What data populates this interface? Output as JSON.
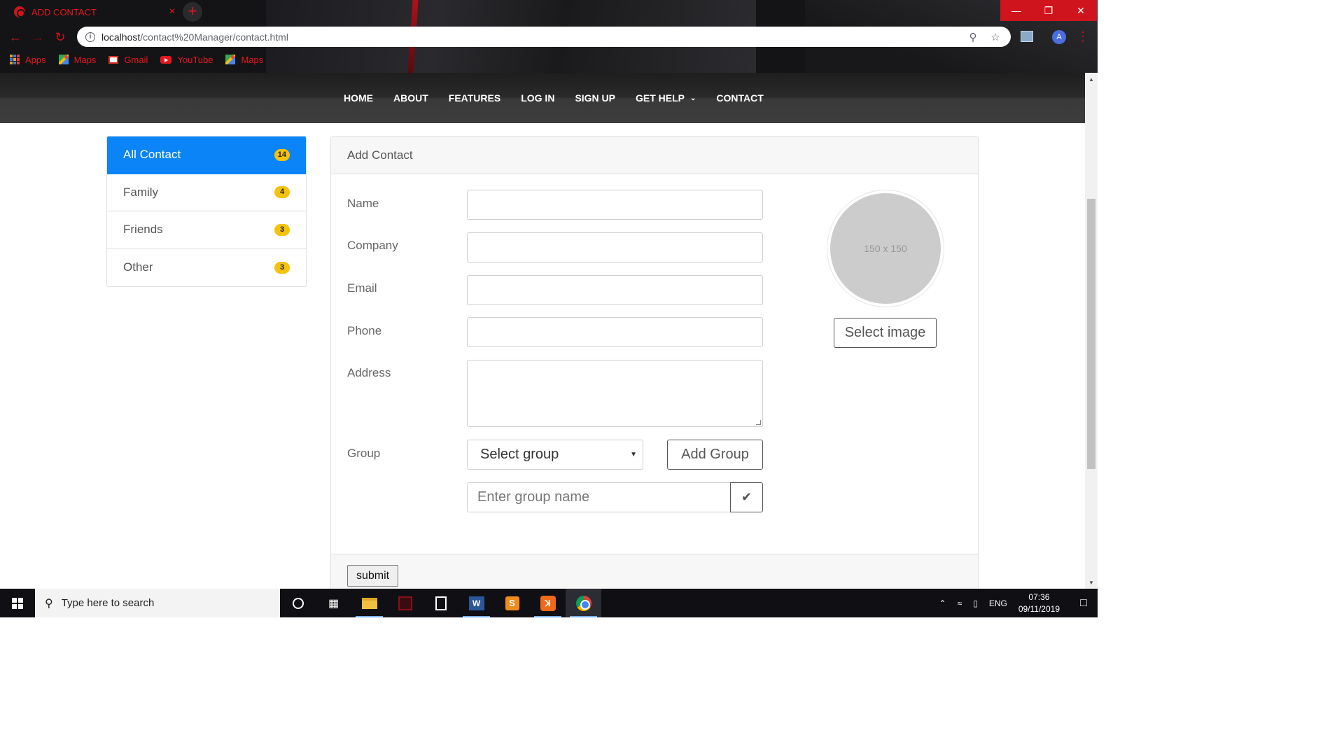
{
  "browser": {
    "tab_title": "ADD CONTACT",
    "tab_close": "×",
    "new_tab": "+",
    "url_host": "localhost",
    "url_path": "/contact%20Manager/contact.html",
    "info_icon": "i",
    "profile_initial": "A",
    "window_controls": {
      "minimize": "—",
      "restore": "❐",
      "close": "✕"
    },
    "bookmarks": [
      {
        "label": "Apps",
        "icon": "apps-icon"
      },
      {
        "label": "Maps",
        "icon": "maps-icon"
      },
      {
        "label": "Gmail",
        "icon": "gmail-icon"
      },
      {
        "label": "YouTube",
        "icon": "youtube-icon"
      },
      {
        "label": "Maps",
        "icon": "maps-icon"
      }
    ],
    "accent_color": "#e8161f"
  },
  "navbar": {
    "items": [
      "HOME",
      "ABOUT",
      "FEATURES",
      "LOG IN",
      "SIGN UP",
      "GET HELP",
      "CONTACT"
    ],
    "dropdown_caret": "⌄"
  },
  "sidebar": {
    "groups": [
      {
        "label": "All Contact",
        "count": "14",
        "active": true
      },
      {
        "label": "Family",
        "count": "4",
        "active": false
      },
      {
        "label": "Friends",
        "count": "3",
        "active": false
      },
      {
        "label": "Other",
        "count": "3",
        "active": false
      }
    ],
    "active_color": "#0a84f6",
    "badge_color": "#f5c20c"
  },
  "form": {
    "title": "Add Contact",
    "labels": {
      "name": "Name",
      "company": "Company",
      "email": "Email",
      "phone": "Phone",
      "address": "Address",
      "group": "Group"
    },
    "values": {
      "name": "",
      "company": "",
      "email": "",
      "phone": "",
      "address": ""
    },
    "group_select": "Select group",
    "add_group_button": "Add Group",
    "group_name_placeholder": "Enter group name",
    "confirm_icon": "✔",
    "avatar_placeholder": "150 x 150",
    "select_image_button": "Select image",
    "submit_button": "submit"
  },
  "taskbar": {
    "search_placeholder": "Type here to search",
    "word_letter": "W",
    "sublime_letter": "S",
    "xampp_letter": "ꓘ",
    "language": "ENG",
    "time": "07:36",
    "date": "09/11/2019"
  }
}
